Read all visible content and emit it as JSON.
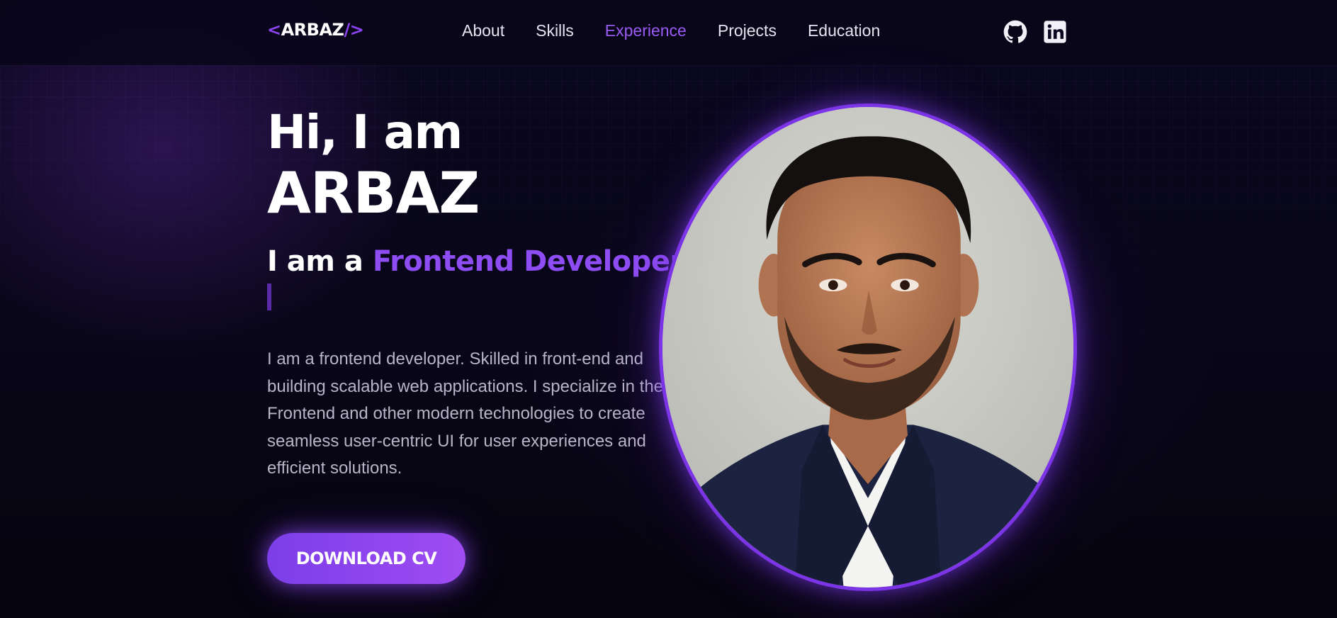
{
  "brand": {
    "open": "<",
    "name": "ARBAZ",
    "close": "/>",
    "accent_color": "#8b45f0"
  },
  "nav": {
    "items": [
      {
        "label": "About",
        "active": false
      },
      {
        "label": "Skills",
        "active": false
      },
      {
        "label": "Experience",
        "active": true
      },
      {
        "label": "Projects",
        "active": false
      },
      {
        "label": "Education",
        "active": false
      }
    ],
    "social": [
      {
        "icon": "github-icon"
      },
      {
        "icon": "linkedin-icon"
      }
    ]
  },
  "hero": {
    "greeting": "Hi, I am",
    "name": "ARBAZ",
    "role_prefix": "I am a ",
    "role_typed": "Frontend Developer",
    "bio": "I am a frontend developer. Skilled in front-end and building scalable web applications. I specialize in the Frontend and other modern technologies to create seamless user-centric UI for user experiences and efficient solutions.",
    "cv_button": "DOWNLOAD CV",
    "portrait_icon": "profile-photo"
  },
  "colors": {
    "background": "#07051a",
    "accent": "#8e4cf3",
    "text": "#ffffff",
    "muted_text": "#b9b4c8"
  }
}
